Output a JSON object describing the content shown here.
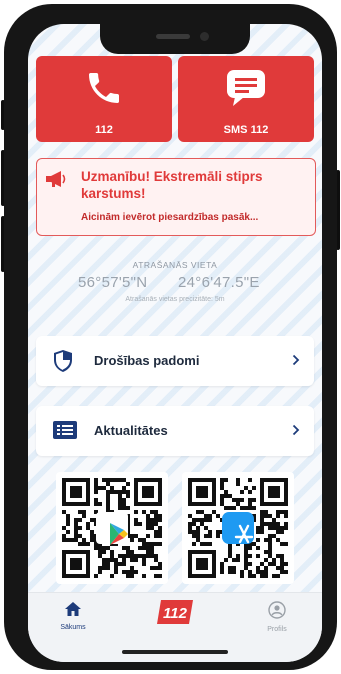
{
  "emergency": {
    "call_label": "112",
    "sms_label": "SMS 112",
    "sms_icon_text": "SMS"
  },
  "alert": {
    "title": "Uzmanību! Ekstremāli stiprs karstums!",
    "message": "Aicinām ievērot piesardzības pasāk..."
  },
  "location": {
    "caption": "ATRAŠANĀS VIETA",
    "latitude": "56°57'5\"N",
    "longitude": "24°6'47.5\"E",
    "accuracy": "Atrašanās vietas precizitāte: 5m"
  },
  "menu": [
    {
      "label": "Drošības padomi",
      "icon": "shield-icon"
    },
    {
      "label": "Aktualitātes",
      "icon": "news-icon"
    }
  ],
  "qr": [
    {
      "store": "google-play",
      "icon": "google-play-icon"
    },
    {
      "store": "app-store",
      "icon": "app-store-icon"
    }
  ],
  "tabs": [
    {
      "label": "Sākums",
      "icon": "home-icon",
      "active": true
    },
    {
      "label": "112",
      "icon": "logo-112-icon"
    },
    {
      "label": "Profils",
      "icon": "profile-icon"
    }
  ],
  "colors": {
    "accent_red": "#e03a3a",
    "navy": "#1d3b7a",
    "app_store_blue": "#1e9af2"
  }
}
